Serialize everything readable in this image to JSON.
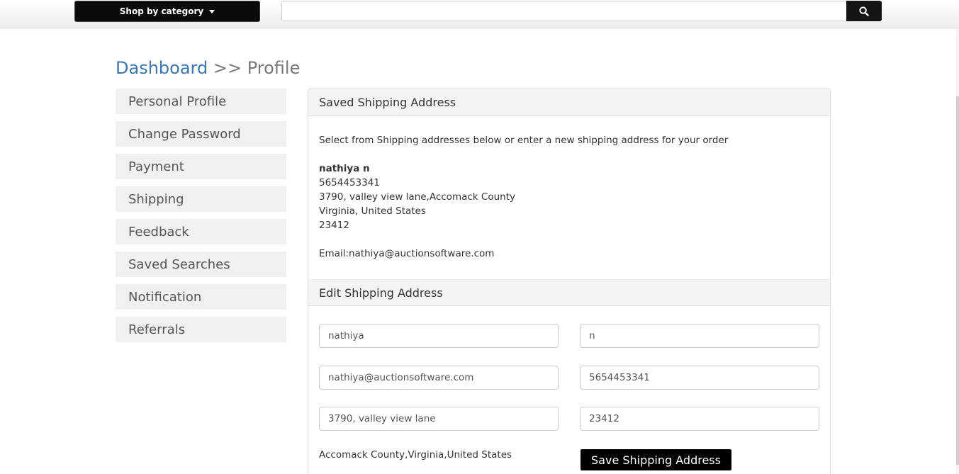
{
  "header": {
    "category_button": "Shop by category",
    "search_placeholder": "",
    "search_icon": "search-icon"
  },
  "breadcrumb": {
    "link": "Dashboard",
    "separator": ">>",
    "current": "Profile"
  },
  "sidebar": {
    "items": [
      {
        "label": "Personal Profile"
      },
      {
        "label": "Change Password"
      },
      {
        "label": "Payment"
      },
      {
        "label": "Shipping"
      },
      {
        "label": "Feedback"
      },
      {
        "label": "Saved Searches"
      },
      {
        "label": "Notification"
      },
      {
        "label": "Referrals"
      }
    ]
  },
  "saved_address": {
    "title": "Saved Shipping Address",
    "intro": "Select from Shipping addresses below or enter a new shipping address for your order",
    "name": "nathiya n",
    "phone": "5654453341",
    "street": "3790, valley view lane,Accomack County",
    "region": "Virginia, United States",
    "zip": "23412",
    "email": "Email:nathiya@auctionsoftware.com"
  },
  "edit_address": {
    "title": "Edit Shipping Address",
    "first_name": "nathiya",
    "last_name": "n",
    "email": "nathiya@auctionsoftware.com",
    "phone": "5654453341",
    "address": "3790, valley view lane",
    "zip": "23412",
    "location": "Accomack County,Virginia,United States",
    "save_label": "Save Shipping Address"
  },
  "colors": {
    "link": "#3d76ad",
    "button": "#000000",
    "panel_header": "#f4f4f4"
  }
}
